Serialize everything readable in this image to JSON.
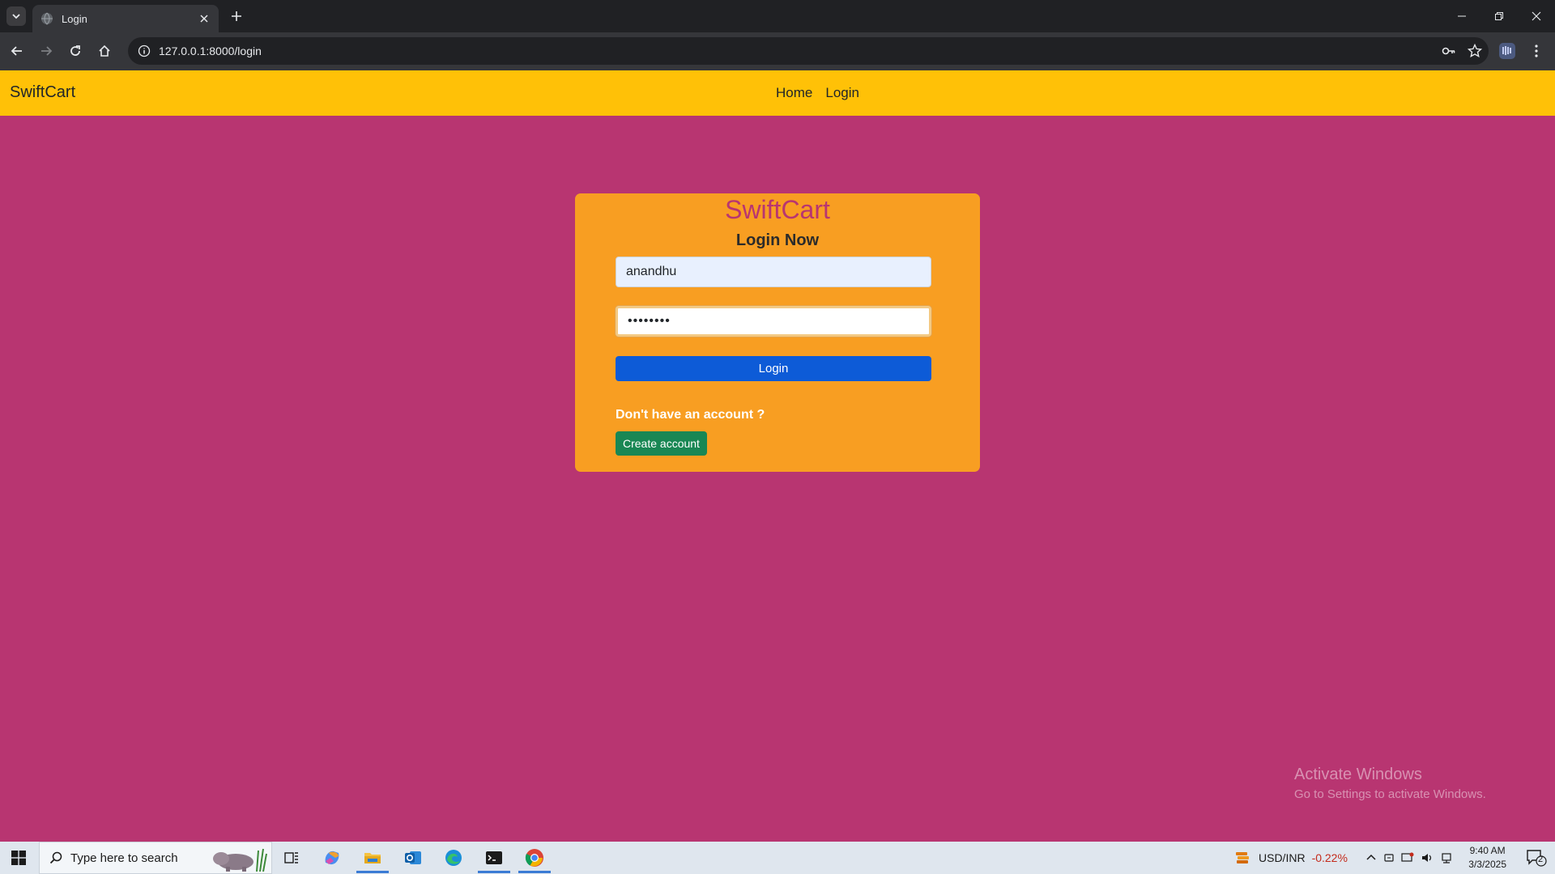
{
  "browser": {
    "tab_title": "Login",
    "url": "127.0.0.1:8000/login"
  },
  "navbar": {
    "brand": "SwiftCart",
    "links": [
      "Home",
      "Login"
    ]
  },
  "login_card": {
    "title": "SwiftCart",
    "subtitle": "Login Now",
    "username_value": "anandhu",
    "password_value": "anandhu1",
    "login_button": "Login",
    "no_account_text": "Don't have an account ?",
    "create_account_button": "Create account"
  },
  "watermark": {
    "line1": "Activate Windows",
    "line2": "Go to Settings to activate Windows."
  },
  "taskbar": {
    "search_placeholder": "Type here to search",
    "currency_pair": "USD/INR",
    "currency_change": "-0.22%",
    "time": "9:40 AM",
    "date": "3/3/2025",
    "notification_count": "2"
  },
  "colors": {
    "page_bg": "#b83571",
    "navbar_bg": "#ffc107",
    "card_bg": "#f89e22",
    "login_button": "#0d5bd7",
    "create_button": "#198754"
  },
  "icons": [
    "chevron-down-icon",
    "globe-icon",
    "close-icon",
    "plus-icon",
    "back-arrow-icon",
    "forward-arrow-icon",
    "reload-icon",
    "home-icon",
    "info-icon",
    "key-icon",
    "star-icon",
    "extension-icon",
    "kebab-menu-icon",
    "windows-start-icon",
    "search-icon",
    "task-view-icon",
    "copilot-icon",
    "file-explorer-icon",
    "outlook-icon",
    "edge-icon",
    "terminal-icon",
    "chrome-icon"
  ]
}
